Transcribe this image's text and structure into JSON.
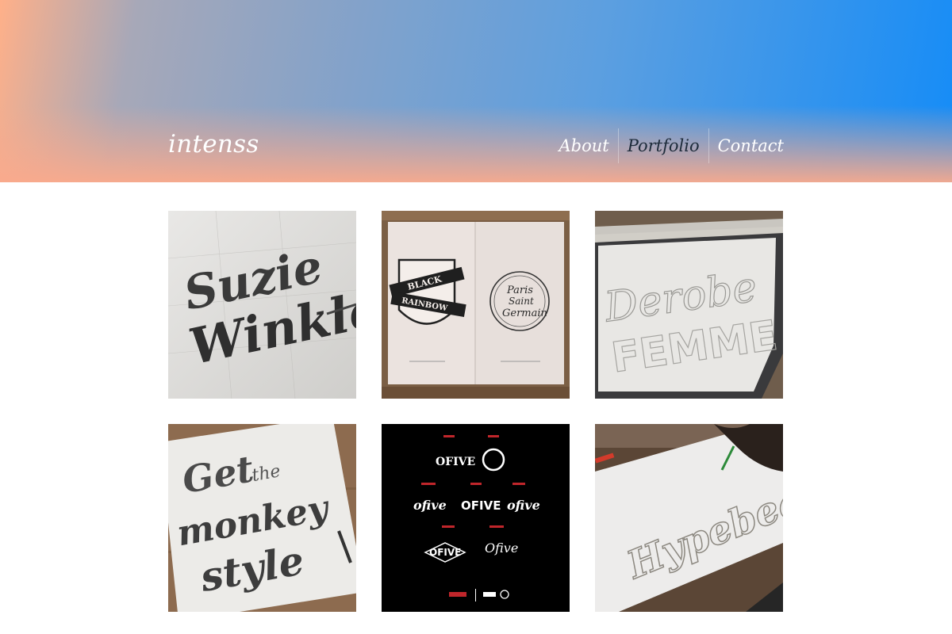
{
  "header": {
    "brand": "intenss",
    "nav": [
      {
        "label": "About",
        "active": false
      },
      {
        "label": "Portfolio",
        "active": true
      },
      {
        "label": "Contact",
        "active": false
      }
    ]
  },
  "portfolio": {
    "items": [
      {
        "image": "suzie-winkle-sketch"
      },
      {
        "image": "black-rainbow-book-spread"
      },
      {
        "image": "derobe-pencil-sketch"
      },
      {
        "image": "get-the-monkey-style-sketch"
      },
      {
        "image": "ofive-logo-set"
      },
      {
        "image": "hypebeast-sketch"
      }
    ],
    "tile2_texts": [
      "BLACK",
      "RAINBOW",
      "Paris",
      "Saint",
      "Germain"
    ],
    "tile3_texts": [
      "Derobe",
      "FEMME"
    ],
    "tile4_texts": [
      "Get",
      "the",
      "monkey",
      "style"
    ],
    "tile5_texts": [
      "OFIVE",
      "ofive",
      "OFIVE",
      "ofive",
      "OFIVE",
      "Ofive"
    ],
    "tile1_texts": [
      "Suzie",
      "Winkle"
    ],
    "tile6_texts": [
      "Hypebeast"
    ]
  },
  "colors": {
    "header_gradient_start": "#ffb089",
    "header_gradient_end": "#158cf7",
    "nav_active": "#1d2b3a"
  }
}
